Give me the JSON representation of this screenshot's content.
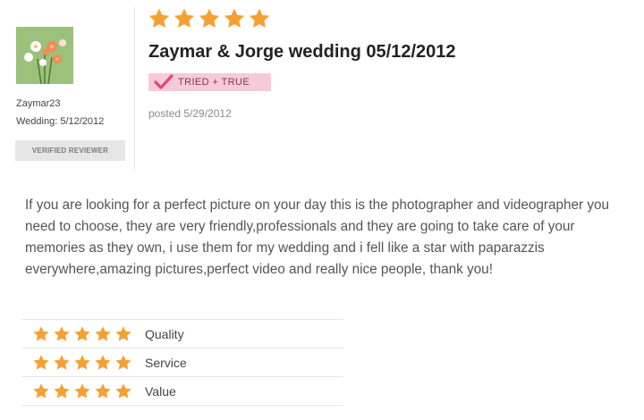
{
  "reviewer": {
    "name": "Zaymar23",
    "wedding_label": "Wedding: 5/12/2012",
    "verified_label": "VERIFIED REVIEWER"
  },
  "review": {
    "overall_rating": 5,
    "title": "Zaymar & Jorge wedding 05/12/2012",
    "tried_badge": "TRIED + TRUE",
    "posted": "posted 5/29/2012",
    "body": "If you are looking for a perfect picture on your day this is the photographer and videographer you need to choose, they are very friendly,professionals and they are going to take care of your memories as they own, i use them for my wedding and i fell like a star with paparazzis everywhere,amazing pictures,perfect video and really nice people, thank you!"
  },
  "ratings": [
    {
      "label": "Quality",
      "stars": 5
    },
    {
      "label": "Service",
      "stars": 5
    },
    {
      "label": "Value",
      "stars": 5
    }
  ],
  "colors": {
    "star": "#f5a033",
    "badge_pink": "#f7c9d9",
    "check_pink": "#e2457a"
  }
}
